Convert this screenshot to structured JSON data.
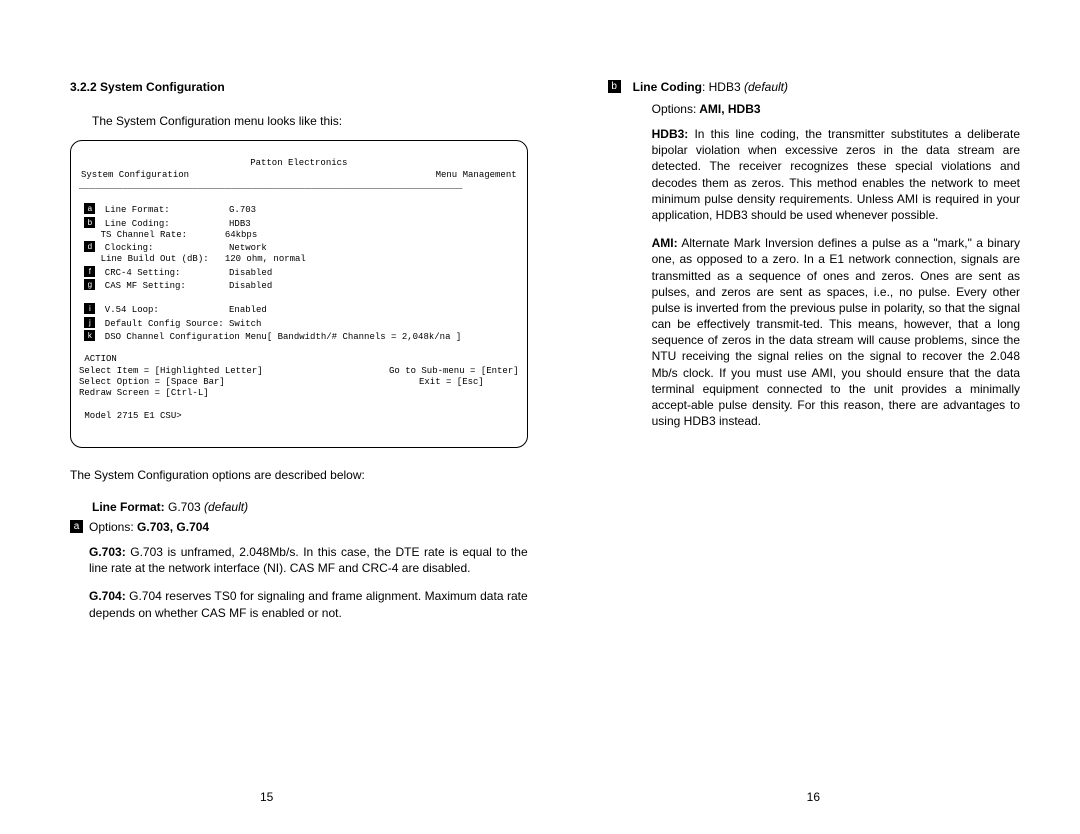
{
  "left": {
    "heading": "3.2.2  System Configuration",
    "intro": "The System Configuration menu looks like this:",
    "screen": {
      "title1": "Patton Electronics",
      "title2_left": "System Configuration",
      "title2_right": "Menu Management",
      "rule": "_______________________________________________________________________",
      "rows": [
        {
          "m": "a",
          "label": "Line Format:",
          "val": "G.703"
        },
        {
          "m": "b",
          "label": "Line Coding:",
          "val": "HDB3"
        },
        {
          "m": " ",
          "label": "TS Channel Rate:",
          "val": "64kbps"
        },
        {
          "m": "d",
          "label": "Clocking:",
          "val": "Network"
        },
        {
          "m": " ",
          "label": "Line Build Out (dB):",
          "val": "120 ohm, normal"
        },
        {
          "m": "f",
          "label": "CRC-4 Setting:",
          "val": "Disabled"
        },
        {
          "m": "g",
          "label": "CAS MF Setting:",
          "val": "Disabled"
        }
      ],
      "rows2": [
        {
          "m": "i",
          "label": "V.54 Loop:",
          "val": "Enabled"
        },
        {
          "m": "j",
          "label": "Default Config Source:",
          "val": "Switch"
        },
        {
          "m": "k",
          "label": "DSO Channel Configuration Menu",
          "val": "[ Bandwidth/# Channels = 2,048k/na ]"
        }
      ],
      "action_hdr": "ACTION",
      "action1_l": "Select Item = [Highlighted Letter]",
      "action1_r": "Go to Sub-menu = [Enter]",
      "action2_l": "Select Option = [Space Bar]",
      "action2_r": "Exit = [Esc]",
      "action3": "Redraw Screen = [Ctrl-L]",
      "prompt": "Model 2715 E1 CSU>"
    },
    "desc_below": "The System Configuration options are described below:",
    "lf_title_bold": "Line Format:",
    "lf_title_val": "  G.703",
    "lf_title_ital": "  (default)",
    "a_marker": "a",
    "a_options_label": "Options:",
    "a_options_val": " G.703, G.704",
    "g703_bold": "G.703:",
    "g703_text": "  G.703 is unframed, 2.048Mb/s. In this case, the DTE rate is equal to the line rate at the network interface (NI). CAS MF and CRC-4 are disabled.",
    "g704_bold": "G.704:",
    "g704_text": "  G.704 reserves TS0 for signaling and frame alignment. Maximum data rate depends on whether CAS MF is enabled or not.",
    "page_num": "15"
  },
  "right": {
    "b_marker": "b",
    "lc_bold": "Line Coding",
    "lc_val": ":  HDB3",
    "lc_ital": "  (default)",
    "opts_label": "Options:",
    "opts_val": " AMI, HDB3",
    "hdb3_bold": "HDB3:",
    "hdb3_text": "  In this line coding, the transmitter substitutes a deliberate bipolar violation when excessive zeros in the data stream are detected. The receiver recognizes these special violations and decodes them as zeros. This method enables the network to meet minimum pulse density requirements. Unless AMI is required in your application, HDB3 should be used whenever possible.",
    "ami_bold": "AMI:",
    "ami_text": "  Alternate Mark Inversion defines a pulse as a \"mark,\" a binary one, as opposed to a zero. In a E1 network connection, signals are transmitted as a sequence of ones and zeros. Ones are sent as pulses, and zeros are sent as spaces, i.e., no pulse.  Every other pulse is inverted from the previous pulse in polarity, so that the signal can be effectively transmit-ted. This means, however, that a long sequence of zeros in the data stream will cause problems, since the NTU receiving the signal relies on the signal to recover the 2.048 Mb/s clock. If you must use AMI, you should ensure that the data terminal equipment connected to the unit provides a minimally accept-able pulse density. For this reason, there are advantages to using HDB3 instead.",
    "page_num": "16"
  }
}
